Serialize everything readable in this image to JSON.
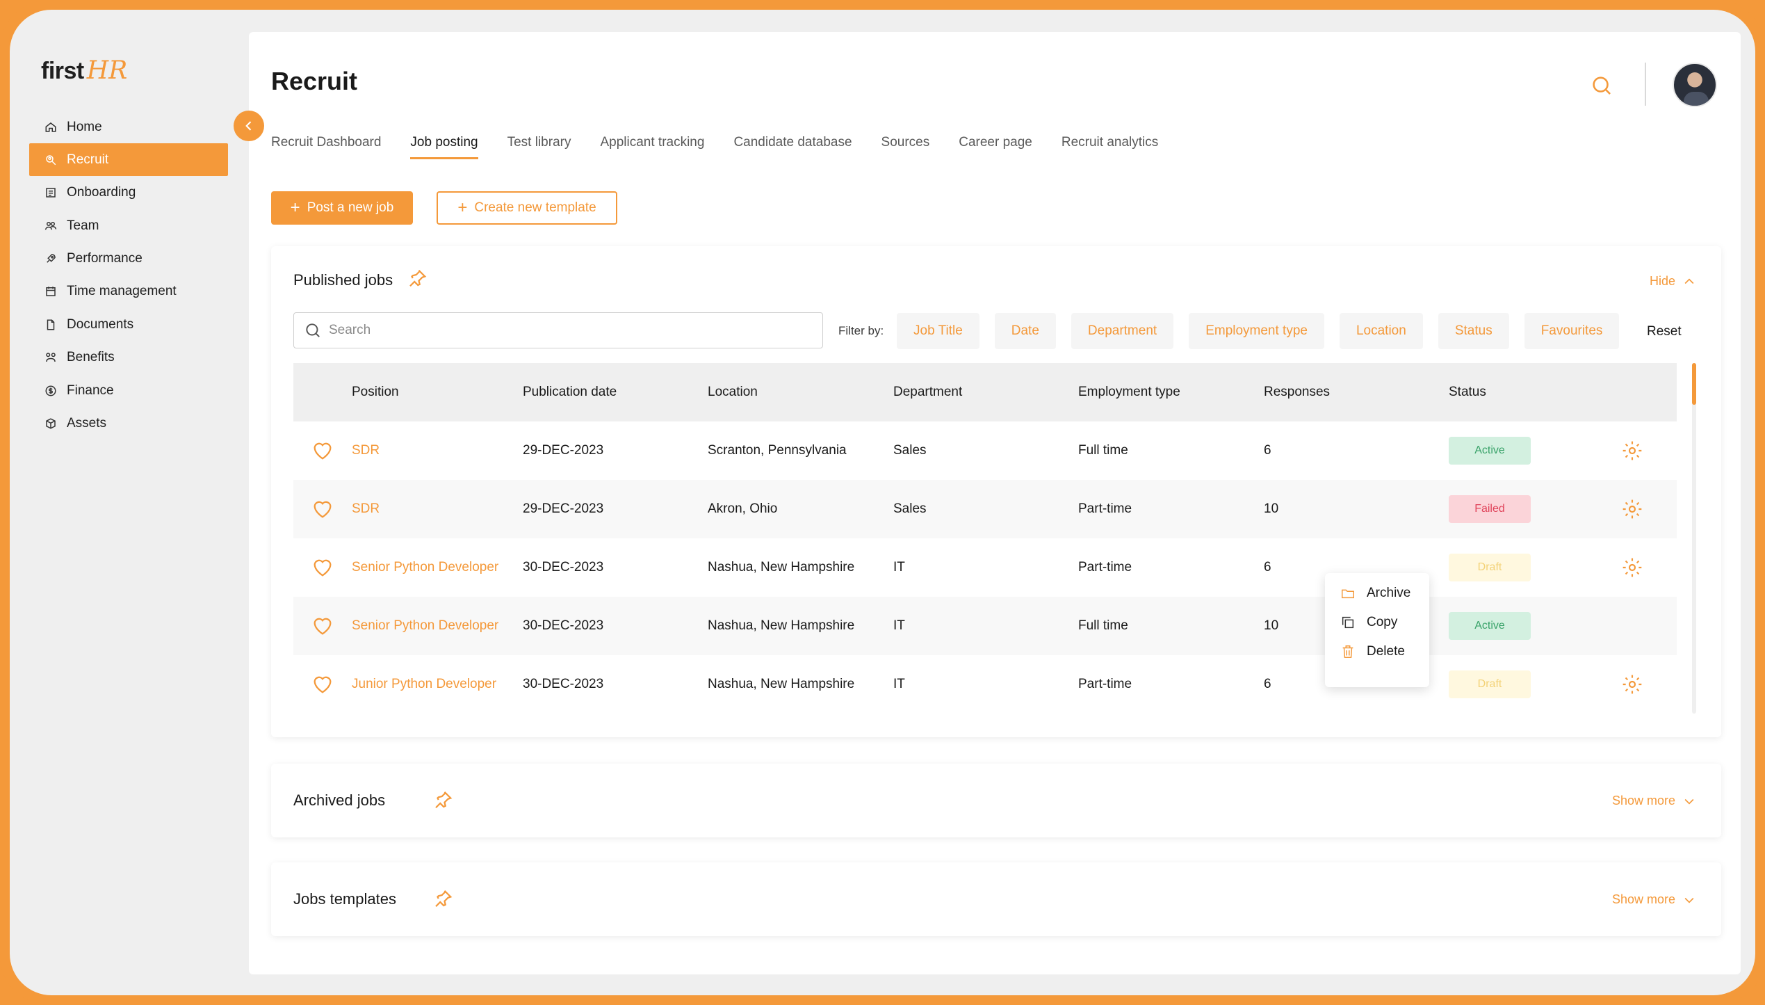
{
  "brand": {
    "first": "first",
    "hr": "HR"
  },
  "sidebar": {
    "items": [
      {
        "label": "Home",
        "icon": "home-icon"
      },
      {
        "label": "Recruit",
        "icon": "search-person-icon"
      },
      {
        "label": "Onboarding",
        "icon": "onboarding-icon"
      },
      {
        "label": "Team",
        "icon": "team-icon"
      },
      {
        "label": "Performance",
        "icon": "rocket-icon"
      },
      {
        "label": "Time management",
        "icon": "calendar-icon"
      },
      {
        "label": "Documents",
        "icon": "document-icon"
      },
      {
        "label": "Benefits",
        "icon": "benefits-icon"
      },
      {
        "label": "Finance",
        "icon": "dollar-icon"
      },
      {
        "label": "Assets",
        "icon": "box-icon"
      }
    ]
  },
  "header": {
    "title": "Recruit"
  },
  "tabs": [
    "Recruit Dashboard",
    "Job posting",
    "Test library",
    "Applicant tracking",
    "Candidate database",
    "Sources",
    "Career page",
    "Recruit analytics"
  ],
  "actions": {
    "post_job": "Post a new job",
    "create_template": "Create new template"
  },
  "published": {
    "title": "Published jobs",
    "hide": "Hide",
    "search_placeholder": "Search",
    "filter_label": "Filter by:",
    "filters": [
      "Job Title",
      "Date",
      "Department",
      "Employment type",
      "Location",
      "Status",
      "Favourites"
    ],
    "reset": "Reset",
    "columns": [
      "Position",
      "Publication date",
      "Location",
      "Department",
      "Employment type",
      "Responses",
      "Status"
    ],
    "rows": [
      {
        "position": "SDR",
        "date": "29-DEC-2023",
        "location": "Scranton, Pennsylvania",
        "department": "Sales",
        "type": "Full time",
        "responses": "6",
        "status": "Active"
      },
      {
        "position": "SDR",
        "date": "29-DEC-2023",
        "location": "Akron, Ohio",
        "department": "Sales",
        "type": "Part-time",
        "responses": "10",
        "status": "Failed"
      },
      {
        "position": "Senior Python Developer",
        "date": "30-DEC-2023",
        "location": "Nashua, New Hampshire",
        "department": "IT",
        "type": "Part-time",
        "responses": "6",
        "status": "Draft"
      },
      {
        "position": "Senior Python Developer",
        "date": "30-DEC-2023",
        "location": "Nashua, New Hampshire",
        "department": "IT",
        "type": "Full time",
        "responses": "10",
        "status": "Active"
      },
      {
        "position": "Junior Python Developer",
        "date": "30-DEC-2023",
        "location": "Nashua, New Hampshire",
        "department": "IT",
        "type": "Part-time",
        "responses": "6",
        "status": "Draft"
      }
    ]
  },
  "context_menu": [
    "Archive",
    "Copy",
    "Delete"
  ],
  "archived": {
    "title": "Archived jobs",
    "action": "Show more"
  },
  "templates": {
    "title": "Jobs templates",
    "action": "Show more"
  },
  "colors": {
    "accent": "#f4993a",
    "active": "#3aa36a",
    "failed": "#e0435a",
    "draft": "#f3d277"
  }
}
